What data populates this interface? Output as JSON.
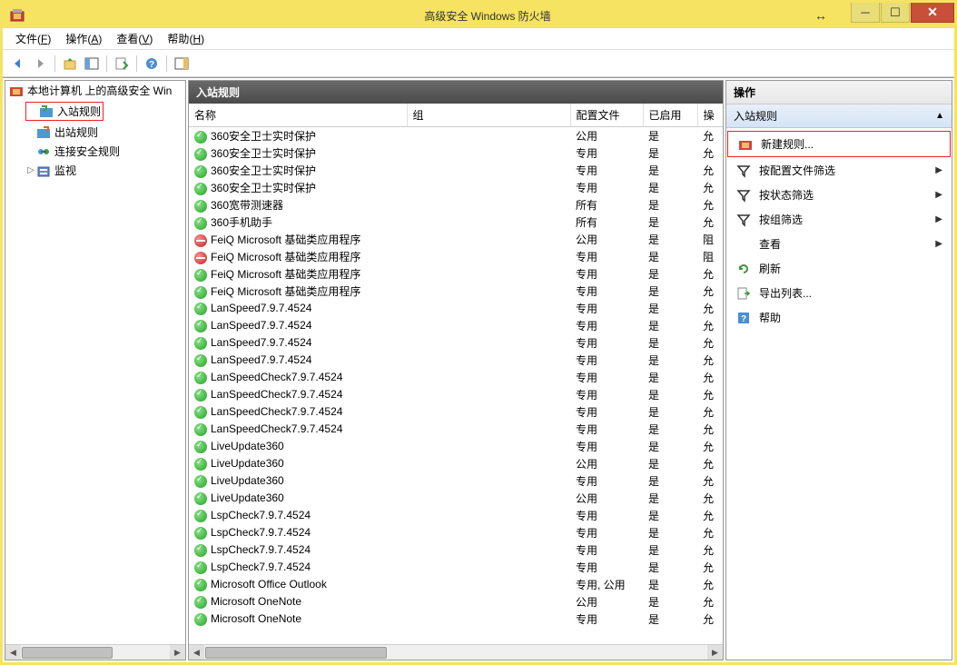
{
  "titlebar": {
    "title": "高级安全 Windows 防火墙"
  },
  "menubar": [
    {
      "label": "文件",
      "key": "F"
    },
    {
      "label": "操作",
      "key": "A"
    },
    {
      "label": "查看",
      "key": "V"
    },
    {
      "label": "帮助",
      "key": "H"
    }
  ],
  "tree": {
    "root": "本地计算机 上的高级安全 Win",
    "children": [
      {
        "label": "入站规则",
        "highlighted": true
      },
      {
        "label": "出站规则"
      },
      {
        "label": "连接安全规则"
      },
      {
        "label": "监视",
        "expandable": true
      }
    ]
  },
  "list": {
    "header": "入站规则",
    "columns": [
      "名称",
      "组",
      "配置文件",
      "已启用",
      "操"
    ],
    "rows": [
      {
        "status": "allow",
        "name": "360安全卫士实时保护",
        "group": "",
        "profile": "公用",
        "enabled": "是",
        "action": "允"
      },
      {
        "status": "allow",
        "name": "360安全卫士实时保护",
        "group": "",
        "profile": "专用",
        "enabled": "是",
        "action": "允"
      },
      {
        "status": "allow",
        "name": "360安全卫士实时保护",
        "group": "",
        "profile": "专用",
        "enabled": "是",
        "action": "允"
      },
      {
        "status": "allow",
        "name": "360安全卫士实时保护",
        "group": "",
        "profile": "专用",
        "enabled": "是",
        "action": "允"
      },
      {
        "status": "allow",
        "name": "360宽带测速器",
        "group": "",
        "profile": "所有",
        "enabled": "是",
        "action": "允"
      },
      {
        "status": "allow",
        "name": "360手机助手",
        "group": "",
        "profile": "所有",
        "enabled": "是",
        "action": "允"
      },
      {
        "status": "block",
        "name": "FeiQ Microsoft 基础类应用程序",
        "group": "",
        "profile": "公用",
        "enabled": "是",
        "action": "阻"
      },
      {
        "status": "block",
        "name": "FeiQ Microsoft 基础类应用程序",
        "group": "",
        "profile": "专用",
        "enabled": "是",
        "action": "阻"
      },
      {
        "status": "allow",
        "name": "FeiQ Microsoft 基础类应用程序",
        "group": "",
        "profile": "专用",
        "enabled": "是",
        "action": "允"
      },
      {
        "status": "allow",
        "name": "FeiQ Microsoft 基础类应用程序",
        "group": "",
        "profile": "专用",
        "enabled": "是",
        "action": "允"
      },
      {
        "status": "allow",
        "name": "LanSpeed7.9.7.4524",
        "group": "",
        "profile": "专用",
        "enabled": "是",
        "action": "允"
      },
      {
        "status": "allow",
        "name": "LanSpeed7.9.7.4524",
        "group": "",
        "profile": "专用",
        "enabled": "是",
        "action": "允"
      },
      {
        "status": "allow",
        "name": "LanSpeed7.9.7.4524",
        "group": "",
        "profile": "专用",
        "enabled": "是",
        "action": "允"
      },
      {
        "status": "allow",
        "name": "LanSpeed7.9.7.4524",
        "group": "",
        "profile": "专用",
        "enabled": "是",
        "action": "允"
      },
      {
        "status": "allow",
        "name": "LanSpeedCheck7.9.7.4524",
        "group": "",
        "profile": "专用",
        "enabled": "是",
        "action": "允"
      },
      {
        "status": "allow",
        "name": "LanSpeedCheck7.9.7.4524",
        "group": "",
        "profile": "专用",
        "enabled": "是",
        "action": "允"
      },
      {
        "status": "allow",
        "name": "LanSpeedCheck7.9.7.4524",
        "group": "",
        "profile": "专用",
        "enabled": "是",
        "action": "允"
      },
      {
        "status": "allow",
        "name": "LanSpeedCheck7.9.7.4524",
        "group": "",
        "profile": "专用",
        "enabled": "是",
        "action": "允"
      },
      {
        "status": "allow",
        "name": "LiveUpdate360",
        "group": "",
        "profile": "专用",
        "enabled": "是",
        "action": "允"
      },
      {
        "status": "allow",
        "name": "LiveUpdate360",
        "group": "",
        "profile": "公用",
        "enabled": "是",
        "action": "允"
      },
      {
        "status": "allow",
        "name": "LiveUpdate360",
        "group": "",
        "profile": "专用",
        "enabled": "是",
        "action": "允"
      },
      {
        "status": "allow",
        "name": "LiveUpdate360",
        "group": "",
        "profile": "公用",
        "enabled": "是",
        "action": "允"
      },
      {
        "status": "allow",
        "name": "LspCheck7.9.7.4524",
        "group": "",
        "profile": "专用",
        "enabled": "是",
        "action": "允"
      },
      {
        "status": "allow",
        "name": "LspCheck7.9.7.4524",
        "group": "",
        "profile": "专用",
        "enabled": "是",
        "action": "允"
      },
      {
        "status": "allow",
        "name": "LspCheck7.9.7.4524",
        "group": "",
        "profile": "专用",
        "enabled": "是",
        "action": "允"
      },
      {
        "status": "allow",
        "name": "LspCheck7.9.7.4524",
        "group": "",
        "profile": "专用",
        "enabled": "是",
        "action": "允"
      },
      {
        "status": "allow",
        "name": "Microsoft Office Outlook",
        "group": "",
        "profile": "专用, 公用",
        "enabled": "是",
        "action": "允"
      },
      {
        "status": "allow",
        "name": "Microsoft OneNote",
        "group": "",
        "profile": "公用",
        "enabled": "是",
        "action": "允"
      },
      {
        "status": "allow",
        "name": "Microsoft OneNote",
        "group": "",
        "profile": "专用",
        "enabled": "是",
        "action": "允"
      }
    ]
  },
  "actions": {
    "header": "操作",
    "group_title": "入站规则",
    "items": [
      {
        "icon": "new",
        "label": "新建规则...",
        "highlighted": true
      },
      {
        "icon": "filter",
        "label": "按配置文件筛选",
        "arrow": true
      },
      {
        "icon": "filter",
        "label": "按状态筛选",
        "arrow": true
      },
      {
        "icon": "filter",
        "label": "按组筛选",
        "arrow": true
      },
      {
        "icon": "none",
        "label": "查看",
        "arrow": true
      },
      {
        "icon": "refresh",
        "label": "刷新"
      },
      {
        "icon": "export",
        "label": "导出列表..."
      },
      {
        "icon": "help",
        "label": "帮助"
      }
    ]
  }
}
